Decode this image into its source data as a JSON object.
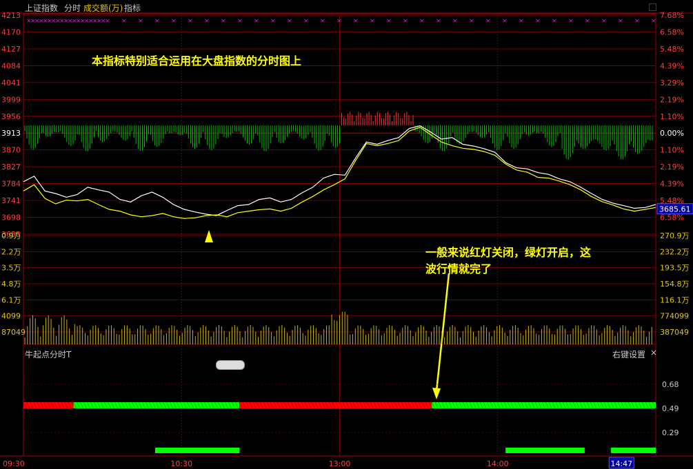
{
  "header": {
    "index_name": "上证指数",
    "mode": "分时",
    "volume_label": "成交额(万)",
    "indicator_tab": "指标"
  },
  "annotations": {
    "main_note": "本指标特别适合运用在大盘指数的分时图上",
    "signal_note_line1": "一般来说红灯关闭，绿灯开启，这",
    "signal_note_line2": "波行情就完了"
  },
  "indicator_panel": {
    "title": "牛起点分时T",
    "settings_label": "右键设置",
    "close_glyph": "×",
    "right_ticks": [
      "0.68",
      "0.49",
      "0.29"
    ]
  },
  "price_axis": {
    "left_ticks": [
      "4213",
      "4170",
      "4127",
      "4084",
      "4041",
      "3999",
      "3956",
      "3913",
      "3870",
      "3827",
      "3784",
      "3741",
      "3698",
      "3655"
    ],
    "right_ticks": [
      "7.68%",
      "6.58%",
      "5.48%",
      "4.39%",
      "3.29%",
      "2.19%",
      "1.10%",
      "0.00%",
      "1.10%",
      "2.19%",
      "4.39%",
      "5.48%",
      "6.58%"
    ],
    "current_value": "3685.61"
  },
  "volume_axis": {
    "left_ticks": [
      "0.9万",
      "2.2万",
      "3.5万",
      "4.8万",
      "6.1万",
      "4099",
      "87049"
    ],
    "right_ticks": [
      "270.9万",
      "232.2万",
      "193.5万",
      "154.8万",
      "116.1万",
      "774099",
      "387049"
    ]
  },
  "time_axis": {
    "ticks": [
      "09:30",
      "10:30",
      "13:00",
      "14:00"
    ],
    "cursor_time": "14:47"
  },
  "colors": {
    "grid_red": "#a00000",
    "white_line": "#ffffff",
    "yellow_line": "#ffff00",
    "bar_green": "#00c000",
    "bar_red": "#ff3030",
    "marker_magenta": "#ff00ff",
    "signal_red": "#ff0000",
    "signal_green": "#00ff00",
    "annotation": "#ffff00"
  },
  "chart_data": {
    "type": "line",
    "x_range": [
      "09:30",
      "15:00"
    ],
    "ylim": [
      3655,
      4213
    ],
    "baseline_price": 3913,
    "series": [
      {
        "values": [
          3760,
          3775,
          3735,
          3728,
          3718,
          3725,
          3745,
          3738,
          3732,
          3712,
          3705,
          3722,
          3732,
          3718,
          3698,
          3685,
          3678,
          3672,
          3668,
          3682,
          3695,
          3698,
          3712,
          3716,
          3705,
          3712,
          3730,
          3745,
          3770,
          3780,
          3778,
          3825,
          3868,
          3862,
          3872,
          3880,
          3905,
          3912,
          3895,
          3876,
          3880,
          3862,
          3857,
          3850,
          3840,
          3812,
          3798,
          3795,
          3785,
          3780,
          3768,
          3760,
          3745,
          3728,
          3712,
          3702,
          3695,
          3688,
          3690,
          3698
        ]
      },
      {
        "values": [
          3735,
          3752,
          3715,
          3700,
          3710,
          3708,
          3712,
          3698,
          3685,
          3680,
          3670,
          3665,
          3668,
          3674,
          3665,
          3660,
          3662,
          3668,
          3670,
          3665,
          3676,
          3680,
          3684,
          3686,
          3680,
          3688,
          3705,
          3720,
          3738,
          3752,
          3768,
          3818,
          3864,
          3858,
          3864,
          3872,
          3898,
          3908,
          3888,
          3868,
          3858,
          3851,
          3848,
          3842,
          3832,
          3808,
          3792,
          3786,
          3772,
          3770,
          3762,
          3752,
          3738,
          3720,
          3706,
          3697,
          3686,
          3680,
          3685,
          3690
        ]
      }
    ],
    "signal_strip": [
      {
        "color": "red",
        "from": "09:30",
        "to": "09:49"
      },
      {
        "color": "green",
        "from": "09:49",
        "to": "10:52"
      },
      {
        "color": "red",
        "from": "10:52",
        "to": "13:35"
      },
      {
        "color": "green",
        "from": "13:35",
        "to": "15:00"
      }
    ],
    "bottom_markers": [
      {
        "from": "10:20",
        "to": "10:52"
      },
      {
        "from": "14:03",
        "to": "14:33"
      },
      {
        "from": "14:43",
        "to": "15:00"
      }
    ]
  }
}
